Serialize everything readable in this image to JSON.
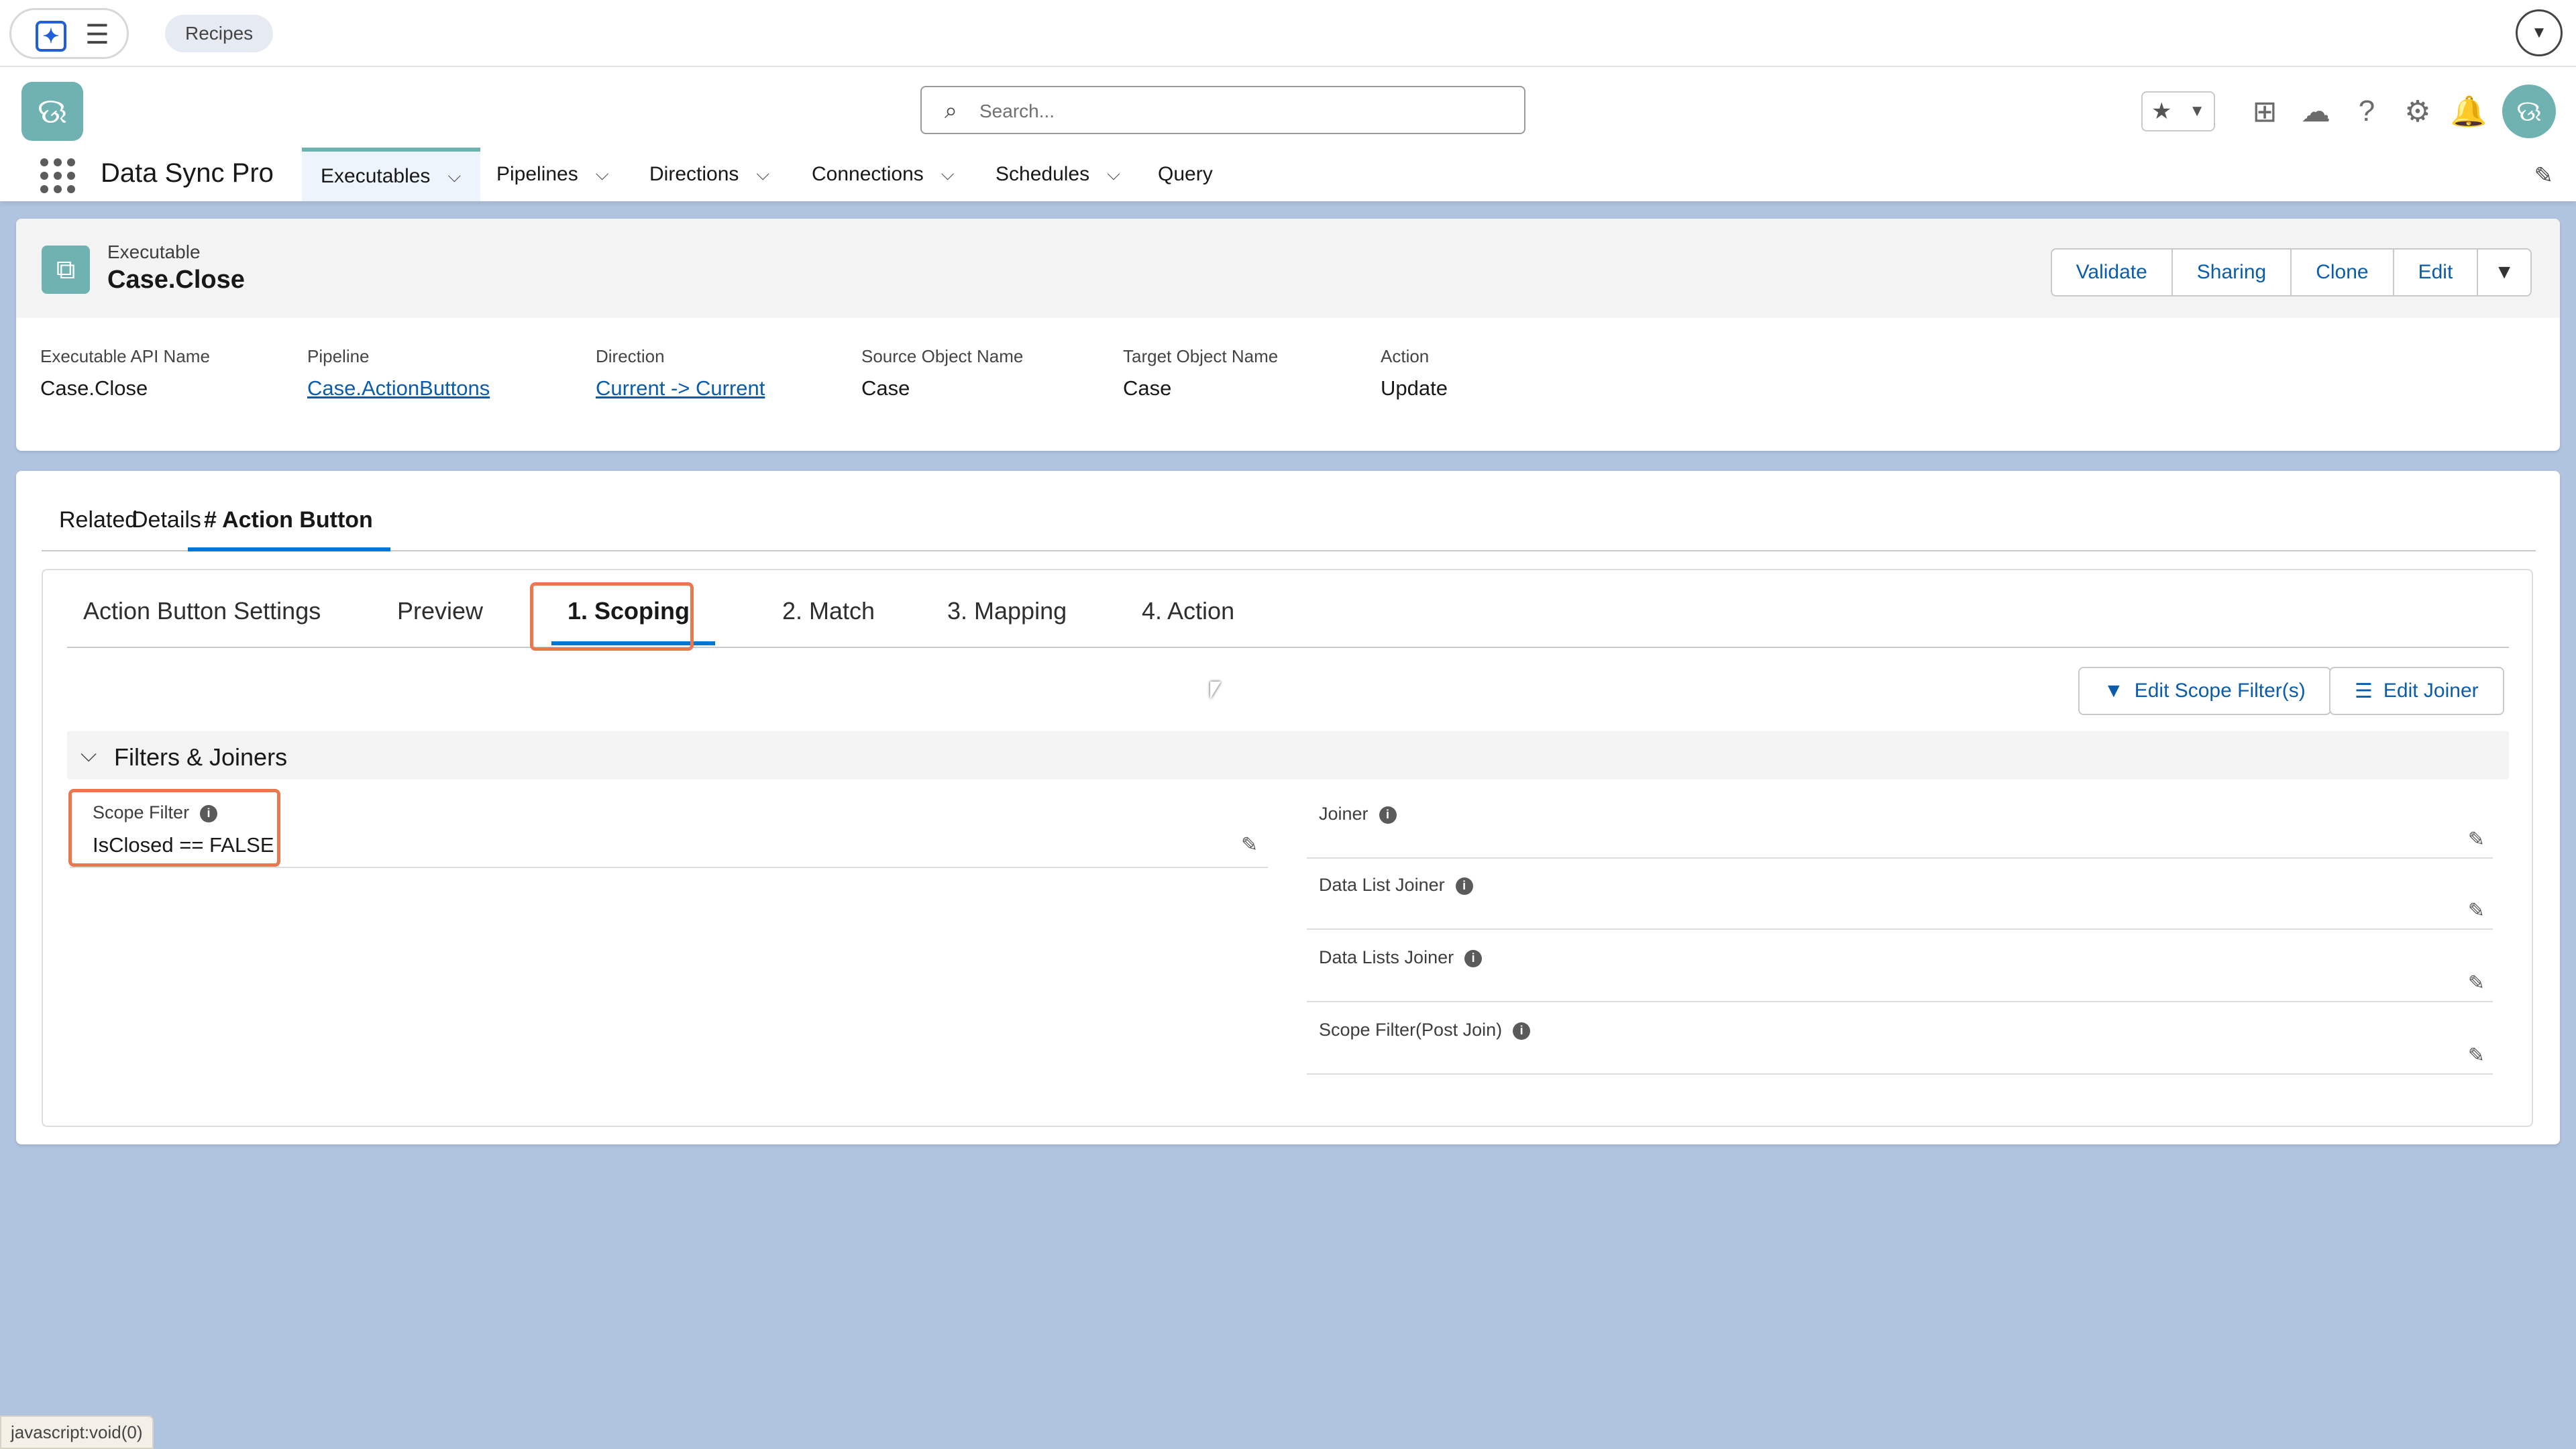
{
  "browser": {
    "chip_label": "Recipes"
  },
  "header": {
    "search_placeholder": "Search...",
    "app_name": "Data Sync Pro",
    "nav": [
      {
        "label": "Executables"
      },
      {
        "label": "Pipelines"
      },
      {
        "label": "Directions"
      },
      {
        "label": "Connections"
      },
      {
        "label": "Schedules"
      },
      {
        "label": "Query"
      }
    ]
  },
  "record": {
    "object_type": "Executable",
    "name": "Case.Close",
    "actions": [
      "Validate",
      "Sharing",
      "Clone",
      "Edit"
    ],
    "fields": [
      {
        "label": "Executable API Name",
        "value": "Case.Close"
      },
      {
        "label": "Pipeline",
        "value": "Case.ActionButtons"
      },
      {
        "label": "Direction",
        "value": "Current -> Current"
      },
      {
        "label": "Source Object Name",
        "value": "Case"
      },
      {
        "label": "Target Object Name",
        "value": "Case"
      },
      {
        "label": "Action",
        "value": "Update"
      }
    ]
  },
  "tabs": [
    "Related",
    "Details",
    "# Action Button"
  ],
  "subtabs": [
    "Action Button Settings",
    "Preview",
    "1. Scoping",
    "2. Match",
    "3. Mapping",
    "4. Action"
  ],
  "buttons": {
    "edit_scope": "Edit Scope Filter(s)",
    "edit_joiner": "Edit Joiner"
  },
  "section": {
    "title": "Filters & Joiners",
    "scope_filter": {
      "label": "Scope Filter",
      "value": "IsClosed == FALSE"
    },
    "right_fields": [
      "Joiner",
      "Data List Joiner",
      "Data Lists Joiner",
      "Scope Filter(Post Join)"
    ]
  },
  "status_bar": "javascript:void(0)",
  "colors": {
    "accent": "#0176d3",
    "brand": "#6fb2b1",
    "highlight": "#e9784e",
    "background": "#b0c4df"
  }
}
